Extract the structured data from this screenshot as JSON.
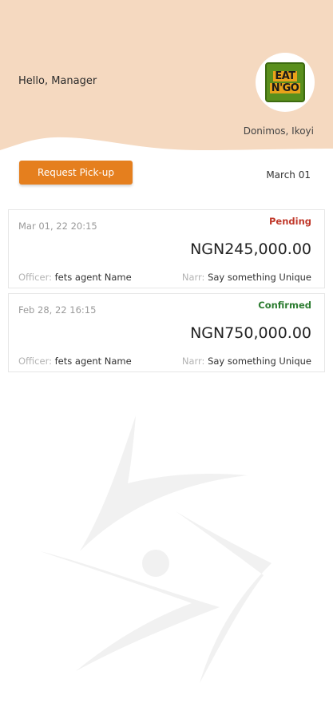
{
  "header": {
    "greeting": "Hello, Manager",
    "location": "Donimos, Ikoyi",
    "logo_lines": [
      "EAT",
      "N'GO"
    ],
    "bg_color": "#f5d9c0"
  },
  "actions": {
    "request_pickup_label": "Request Pick-up",
    "date_label": "March 01",
    "button_color": "#e57f1e"
  },
  "transactions": [
    {
      "datetime": "Mar 01, 22   20:15",
      "status": "Pending",
      "status_color": "#c0392b",
      "amount": "NGN245,000.00",
      "officer_label": "Officer:",
      "officer_name": "fets agent Name",
      "narr_label": "Narr:",
      "narr_text": "Say something Unique"
    },
    {
      "datetime": "Feb 28, 22   16:15",
      "status": "Confirmed",
      "status_color": "#2e7d32",
      "amount": "NGN750,000.00",
      "officer_label": "Officer:",
      "officer_name": "fets agent Name",
      "narr_label": "Narr:",
      "narr_text": "Say something Unique"
    }
  ]
}
